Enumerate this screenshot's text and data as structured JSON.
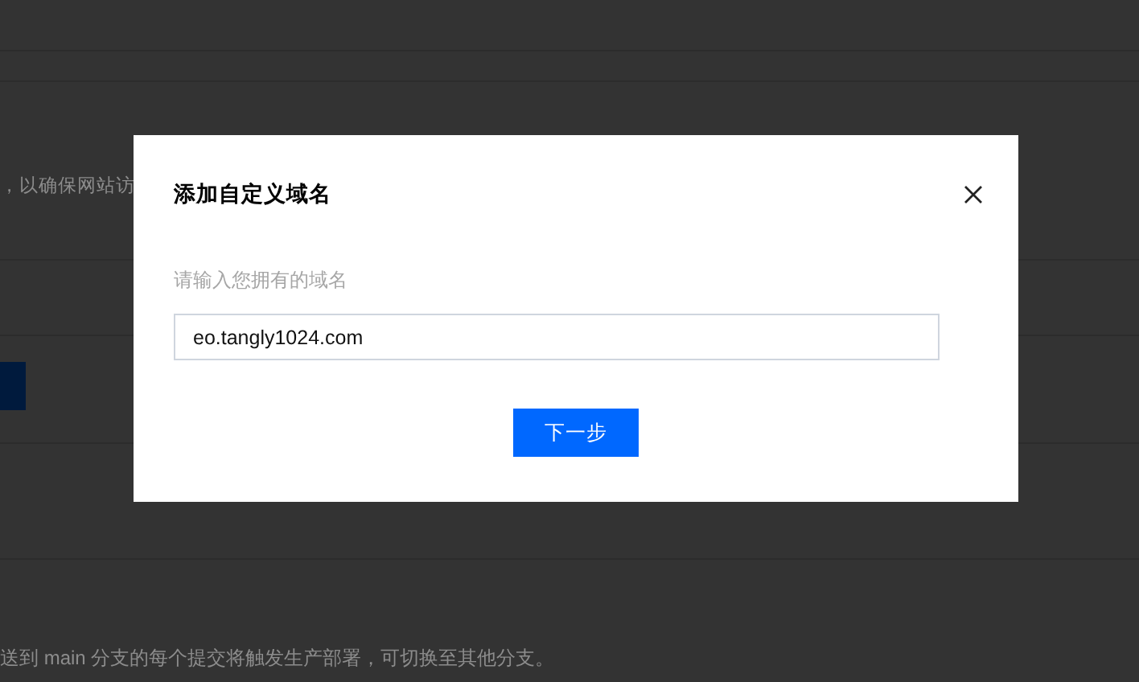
{
  "background_page": {
    "partial_text": "，以确保网站访",
    "branch_note": "送到 main 分支的每个提交将触发生产部署，可切换至其他分支。"
  },
  "dialog": {
    "title": "添加自定义域名",
    "field_label": "请输入您拥有的域名",
    "domain_value": "eo.tangly1024.com",
    "next_button": "下一步"
  }
}
